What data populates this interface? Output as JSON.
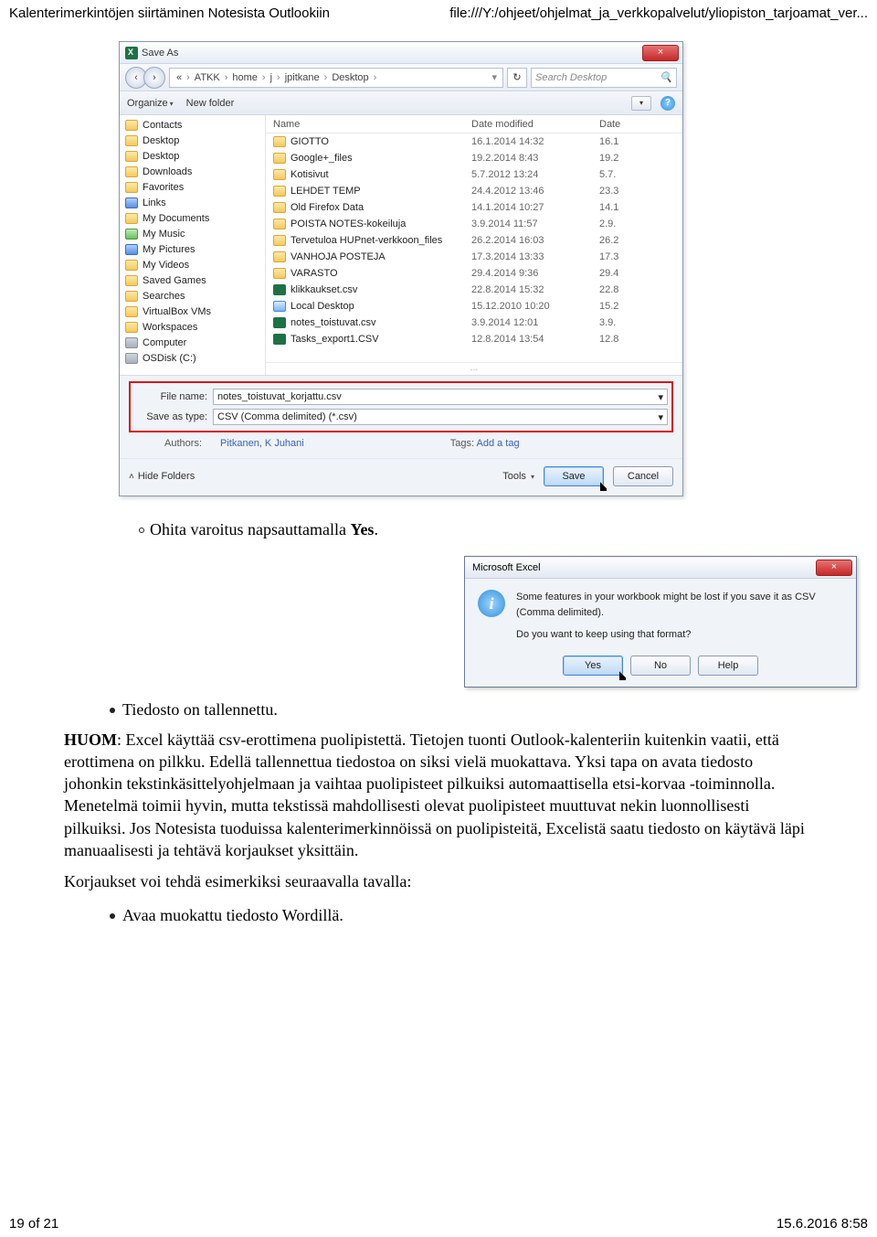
{
  "header": {
    "left": "Kalenterimerkintöjen siirtäminen Notesista Outlookiin",
    "right": "file:///Y:/ohjeet/ohjelmat_ja_verkkopalvelut/yliopiston_tarjoamat_ver..."
  },
  "saveas": {
    "title": "Save As",
    "close_x": "×",
    "nav_back": "‹",
    "nav_fwd": "›",
    "breadcrumb": [
      "«",
      "ATKK",
      "home",
      "j",
      "jpitkane",
      "Desktop"
    ],
    "refresh": "↻",
    "search_placeholder": "Search Desktop",
    "search_icon": "🔍",
    "toolbar": {
      "organize": "Organize",
      "newfolder": "New folder",
      "view_drop": "▾",
      "help": "?"
    },
    "sidebar": [
      {
        "ic": "fold",
        "label": "Contacts"
      },
      {
        "ic": "fold",
        "label": "Desktop"
      },
      {
        "ic": "fold",
        "label": "Desktop"
      },
      {
        "ic": "fold",
        "label": "Downloads"
      },
      {
        "ic": "fold",
        "label": "Favorites"
      },
      {
        "ic": "blue",
        "label": "Links"
      },
      {
        "ic": "fold",
        "label": "My Documents"
      },
      {
        "ic": "green",
        "label": "My Music"
      },
      {
        "ic": "blue",
        "label": "My Pictures"
      },
      {
        "ic": "fold",
        "label": "My Videos"
      },
      {
        "ic": "fold",
        "label": "Saved Games"
      },
      {
        "ic": "fold",
        "label": "Searches"
      },
      {
        "ic": "fold",
        "label": "VirtualBox VMs"
      },
      {
        "ic": "fold",
        "label": "Workspaces"
      },
      {
        "ic": "pc",
        "label": "Computer"
      },
      {
        "ic": "hd",
        "label": "OSDisk (C:)"
      }
    ],
    "cols": {
      "name": "Name",
      "date": "Date modified",
      "date2": "Date"
    },
    "files": [
      {
        "ic": "folder",
        "name": "GIOTTO",
        "date": "16.1.2014 14:32",
        "date2": "16.1"
      },
      {
        "ic": "folder",
        "name": "Google+_files",
        "date": "19.2.2014 8:43",
        "date2": "19.2"
      },
      {
        "ic": "folder",
        "name": "Kotisivut",
        "date": "5.7.2012 13:24",
        "date2": "5.7."
      },
      {
        "ic": "folder",
        "name": "LEHDET TEMP",
        "date": "24.4.2012 13:46",
        "date2": "23.3"
      },
      {
        "ic": "folder",
        "name": "Old Firefox Data",
        "date": "14.1.2014 10:27",
        "date2": "14.1"
      },
      {
        "ic": "folder",
        "name": "POISTA NOTES-kokeiluja",
        "date": "3.9.2014 11:57",
        "date2": "2.9."
      },
      {
        "ic": "folder",
        "name": "Tervetuloa HUPnet-verkkoon_files",
        "date": "26.2.2014 16:03",
        "date2": "26.2"
      },
      {
        "ic": "folder",
        "name": "VANHOJA POSTEJA",
        "date": "17.3.2014 13:33",
        "date2": "17.3"
      },
      {
        "ic": "folder",
        "name": "VARASTO",
        "date": "29.4.2014 9:36",
        "date2": "29.4"
      },
      {
        "ic": "xls",
        "name": "klikkaukset.csv",
        "date": "22.8.2014 15:32",
        "date2": "22.8"
      },
      {
        "ic": "link",
        "name": "Local Desktop",
        "date": "15.12.2010 10:20",
        "date2": "15.2"
      },
      {
        "ic": "xls",
        "name": "notes_toistuvat.csv",
        "date": "3.9.2014 12:01",
        "date2": "3.9."
      },
      {
        "ic": "xls",
        "name": "Tasks_export1.CSV",
        "date": "12.8.2014 13:54",
        "date2": "12.8"
      }
    ],
    "scroll_marker": "···",
    "filename_label": "File name:",
    "filename_value": "notes_toistuvat_korjattu.csv",
    "saveastype_label": "Save as type:",
    "saveastype_value": "CSV (Comma delimited) (*.csv)",
    "authors_label": "Authors:",
    "authors_value": "Pitkanen, K Juhani",
    "tags_label": "Tags:",
    "tags_value": "Add a tag",
    "hide_folders": "Hide Folders",
    "tools": "Tools",
    "save": "Save",
    "cancel": "Cancel",
    "drop": "▾"
  },
  "step1": {
    "text_a": "Ohita varoitus napsauttamalla ",
    "text_b": "Yes",
    "text_c": "."
  },
  "msgbox": {
    "title": "Microsoft Excel",
    "close_x": "×",
    "line1": "Some features in your workbook might be lost if you save it as CSV (Comma delimited).",
    "line2": "Do you want to keep using that format?",
    "yes": "Yes",
    "no": "No",
    "help": "Help"
  },
  "step2": "Tiedosto on tallennettu.",
  "para": {
    "huom": "HUOM",
    "rest": ": Excel käyttää csv-erottimena puolipistettä. Tietojen tuonti Outlook-kalenteriin kuitenkin vaatii, että erottimena on pilkku. Edellä tallennettua tiedostoa on siksi vielä muokattava. Yksi tapa on avata tiedosto johonkin tekstinkäsittelyohjelmaan ja vaihtaa puolipisteet pilkuiksi automaattisella etsi-korvaa -toiminnolla. Menetelmä toimii hyvin, mutta tekstissä mahdollisesti olevat puolipisteet muuttuvat nekin luonnollisesti pilkuiksi. Jos Notesista tuoduissa kalenterimerkinnöissä on puolipisteitä, Excelistä saatu tiedosto on käytävä läpi manuaalisesti ja tehtävä korjaukset yksittäin."
  },
  "para2": "Korjaukset voi tehdä esimerkiksi seuraavalla tavalla:",
  "step3": "Avaa muokattu tiedosto Wordillä.",
  "footer": {
    "left": "19 of 21",
    "right": "15.6.2016 8:58"
  }
}
